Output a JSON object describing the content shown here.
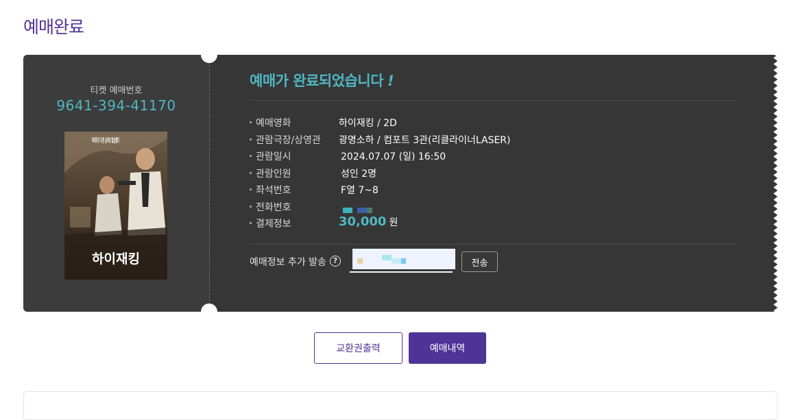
{
  "page": {
    "title": "예매완료"
  },
  "ticket": {
    "booking_label": "티켓 예매번호",
    "booking_number": "9641-394-41170",
    "poster": {
      "title_text": "하이재킹",
      "tagline": "목적지가 다른 승객이 탑승했다"
    },
    "complete_message": "예매가 완료되었습니다",
    "complete_mark": "!",
    "info": [
      {
        "label": "예매영화",
        "value": "하이재킹 / 2D"
      },
      {
        "label": "관람극장/상영관",
        "value": "광명소하 / 컴포트 3관(리클라이너LASER)"
      },
      {
        "label": "관람일시",
        "value": "2024.07.07 (일) 16:50"
      },
      {
        "label": "관람인원",
        "value": "성인 2명"
      },
      {
        "label": "좌석번호",
        "value": "F열 7~8"
      },
      {
        "label": "전화번호",
        "value": ""
      },
      {
        "label": "결제정보",
        "price": "30,000",
        "unit": "원"
      }
    ],
    "send": {
      "label": "예매정보 추가 발송",
      "help_symbol": "?",
      "phone_value": "",
      "button_label": "전송"
    }
  },
  "actions": {
    "print_label": "교환권출력",
    "history_label": "예매내역"
  },
  "colors": {
    "brand": "#503396",
    "accent": "#4fb7c3",
    "ticket_bg": "#363636"
  }
}
